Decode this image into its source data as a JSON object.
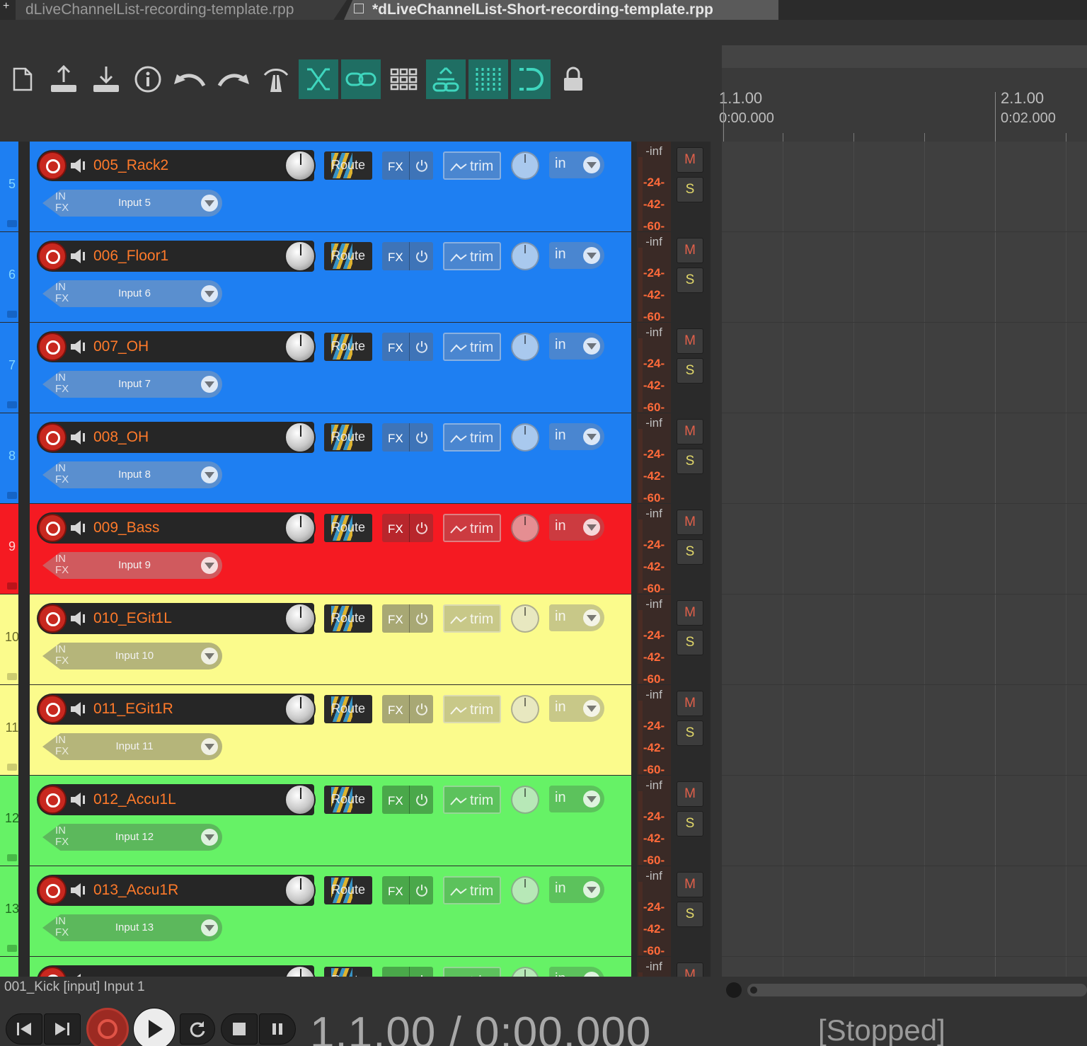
{
  "tabs": [
    {
      "label": "dLiveChannelList-recording-template.rpp",
      "active": false
    },
    {
      "label": "*dLiveChannelList-Short-recording-template.rpp",
      "active": true
    }
  ],
  "toolbar": {
    "icons": [
      "new-project-icon",
      "save-upload-icon",
      "save-download-icon",
      "info-icon",
      "undo-icon",
      "redo-icon",
      "metronome-icon",
      "crossfade-icon",
      "link-icon",
      "grid-icon",
      "ripple-edit-icon",
      "snap-grid-icon",
      "loop-icon",
      "lock-icon"
    ],
    "active_icons": [
      "crossfade-icon",
      "link-icon",
      "ripple-edit-icon",
      "snap-grid-icon",
      "loop-icon"
    ]
  },
  "ruler": {
    "marks": [
      {
        "bar": "1.1.00",
        "time": "0:00.000"
      },
      {
        "bar": "2.1.00",
        "time": "0:02.000"
      }
    ]
  },
  "track_controls": {
    "route_label": "Route",
    "fx_label": "FX",
    "trim_label": "trim",
    "input_mode_label": "in",
    "in_label": "IN",
    "fx_small_label": "FX",
    "mute_label": "M",
    "solo_label": "S",
    "meter_labels": [
      "-inf",
      "-24-",
      "-42-",
      "-60-"
    ]
  },
  "tracks": [
    {
      "number": "5",
      "name": "005_Rack2",
      "input": "Input 5",
      "color": "#1e7ff2",
      "num_color": "#1e7ff2"
    },
    {
      "number": "6",
      "name": "006_Floor1",
      "input": "Input 6",
      "color": "#1e7ff2",
      "num_color": "#1e7ff2"
    },
    {
      "number": "7",
      "name": "007_OH",
      "input": "Input 7",
      "color": "#1e7ff2",
      "num_color": "#1e7ff2"
    },
    {
      "number": "8",
      "name": "008_OH",
      "input": "Input 8",
      "color": "#1e7ff2",
      "num_color": "#1e7ff2"
    },
    {
      "number": "9",
      "name": "009_Bass",
      "input": "Input 9",
      "color": "#f51a22",
      "num_color": "#f51a22"
    },
    {
      "number": "10",
      "name": "010_EGit1L",
      "input": "Input 10",
      "color": "#fbfb8c",
      "num_color": "#fbfb8c"
    },
    {
      "number": "11",
      "name": "011_EGit1R",
      "input": "Input 11",
      "color": "#fbfb8c",
      "num_color": "#fbfb8c"
    },
    {
      "number": "12",
      "name": "012_Accu1L",
      "input": "Input 12",
      "color": "#66f266",
      "num_color": "#66f266"
    },
    {
      "number": "13",
      "name": "013_Accu1R",
      "input": "Input 13",
      "color": "#66f266",
      "num_color": "#66f266"
    },
    {
      "number": "",
      "name": "",
      "input": "",
      "color": "#66f266",
      "num_color": "#66f266"
    }
  ],
  "status": {
    "selected_track_info": "001_Kick [input] Input 1"
  },
  "transport": {
    "position": "1.1.00 / 0:00.000",
    "state": "[Stopped]"
  }
}
